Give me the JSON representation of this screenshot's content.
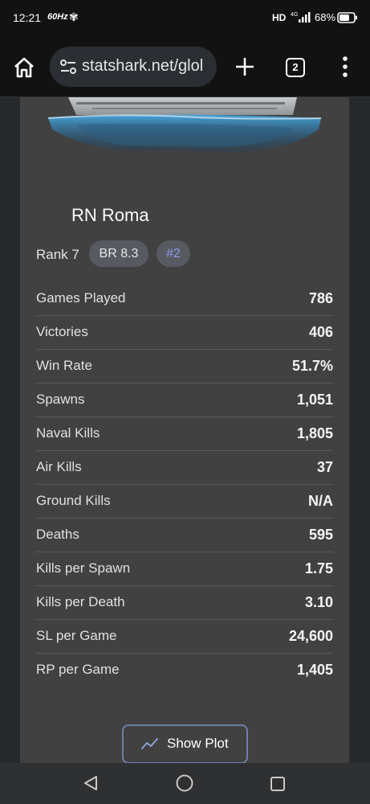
{
  "status": {
    "time": "12:21",
    "refresh": "60Hz",
    "network": "HD",
    "network_gen": "4G",
    "battery": "68%"
  },
  "browser": {
    "url": "statshark.net/glol",
    "tab_count": "2"
  },
  "vehicle": {
    "name": "RN Roma",
    "rank": "Rank 7",
    "br": "BR 8.3",
    "position": "#2"
  },
  "stats": [
    {
      "label": "Games Played",
      "value": "786"
    },
    {
      "label": "Victories",
      "value": "406"
    },
    {
      "label": "Win Rate",
      "value": "51.7%"
    },
    {
      "label": "Spawns",
      "value": "1,051"
    },
    {
      "label": "Naval Kills",
      "value": "1,805"
    },
    {
      "label": "Air Kills",
      "value": "37"
    },
    {
      "label": "Ground Kills",
      "value": "N/A"
    },
    {
      "label": "Deaths",
      "value": "595"
    },
    {
      "label": "Kills per Spawn",
      "value": "1.75"
    },
    {
      "label": "Kills per Death",
      "value": "3.10"
    },
    {
      "label": "SL per Game",
      "value": "24,600"
    },
    {
      "label": "RP per Game",
      "value": "1,405"
    }
  ],
  "actions": {
    "show_plot": "Show Plot"
  },
  "icons": {
    "home": "home-icon",
    "site_settings": "tune-icon",
    "new_tab": "plus-icon",
    "tabs": "tab-switcher-icon",
    "menu": "more-vert-icon",
    "plot": "trending-icon",
    "back": "back-triangle-icon",
    "nav_home": "home-circle-icon",
    "recents": "recents-square-icon"
  },
  "colors": {
    "card": "#414141",
    "badge": "#575a60",
    "rank_badge_text": "#8e9bf0",
    "button_border": "#6e7ea8"
  }
}
